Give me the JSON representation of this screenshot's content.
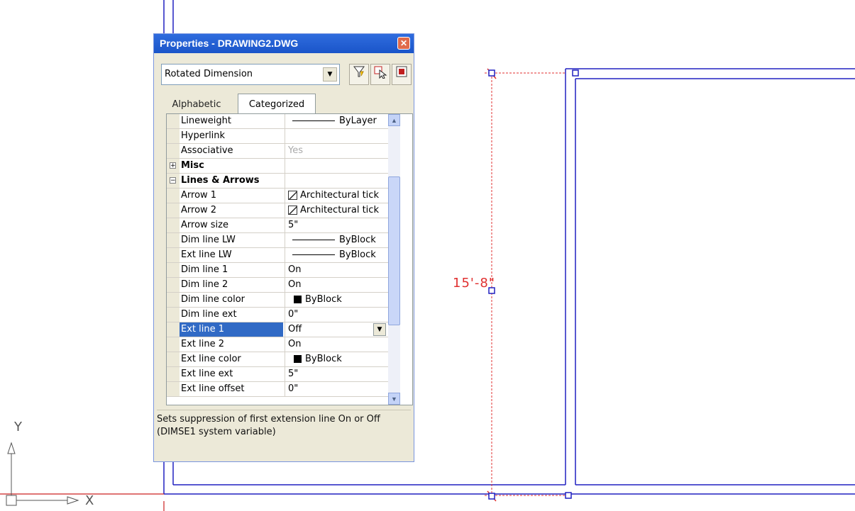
{
  "palette": {
    "title": "Properties - DRAWING2.DWG",
    "object_type": "Rotated Dimension",
    "tabs": [
      "Alphabetic",
      "Categorized"
    ],
    "active_tab": "Categorized",
    "rows": [
      {
        "name": "Lineweight",
        "value": "ByLayer",
        "kind": "lineweight"
      },
      {
        "name": "Hyperlink",
        "value": "",
        "kind": "text"
      },
      {
        "name": "Associative",
        "value": "Yes",
        "kind": "muted"
      },
      {
        "name": "Misc",
        "value": "",
        "kind": "category",
        "expander": "+"
      },
      {
        "name": "Lines & Arrows",
        "value": "",
        "kind": "category",
        "expander": "−"
      },
      {
        "name": "Arrow 1",
        "value": "Architectural tick",
        "kind": "arrow"
      },
      {
        "name": "Arrow 2",
        "value": "Architectural tick",
        "kind": "arrow"
      },
      {
        "name": "Arrow size",
        "value": "5\"",
        "kind": "text"
      },
      {
        "name": "Dim line LW",
        "value": "ByBlock",
        "kind": "lineweight"
      },
      {
        "name": "Ext line LW",
        "value": "ByBlock",
        "kind": "lineweight"
      },
      {
        "name": "Dim line 1",
        "value": "On",
        "kind": "text"
      },
      {
        "name": "Dim line 2",
        "value": "On",
        "kind": "text"
      },
      {
        "name": "Dim line color",
        "value": "ByBlock",
        "kind": "color"
      },
      {
        "name": "Dim line ext",
        "value": "0\"",
        "kind": "text"
      },
      {
        "name": "Ext line 1",
        "value": "Off",
        "kind": "selected"
      },
      {
        "name": "Ext line 2",
        "value": "On",
        "kind": "text"
      },
      {
        "name": "Ext line color",
        "value": "ByBlock",
        "kind": "color"
      },
      {
        "name": "Ext line ext",
        "value": "5\"",
        "kind": "text"
      },
      {
        "name": "Ext line offset",
        "value": "0\"",
        "kind": "text"
      }
    ],
    "description": "Sets suppression of first extension line On or Off (DIMSE1 system variable)"
  },
  "drawing": {
    "dimension_text": "15'-8\"",
    "ucs_x_label": "X",
    "ucs_y_label": "Y"
  },
  "colors": {
    "drawing_lines": "#2020c0",
    "dimension": "#e03030",
    "ucs": "#555555",
    "title_bar": "#2f6cde",
    "selection": "#316ac5"
  },
  "icons": [
    "quick-select-icon",
    "select-objects-icon",
    "pickadd-toggle-icon",
    "close-icon"
  ]
}
